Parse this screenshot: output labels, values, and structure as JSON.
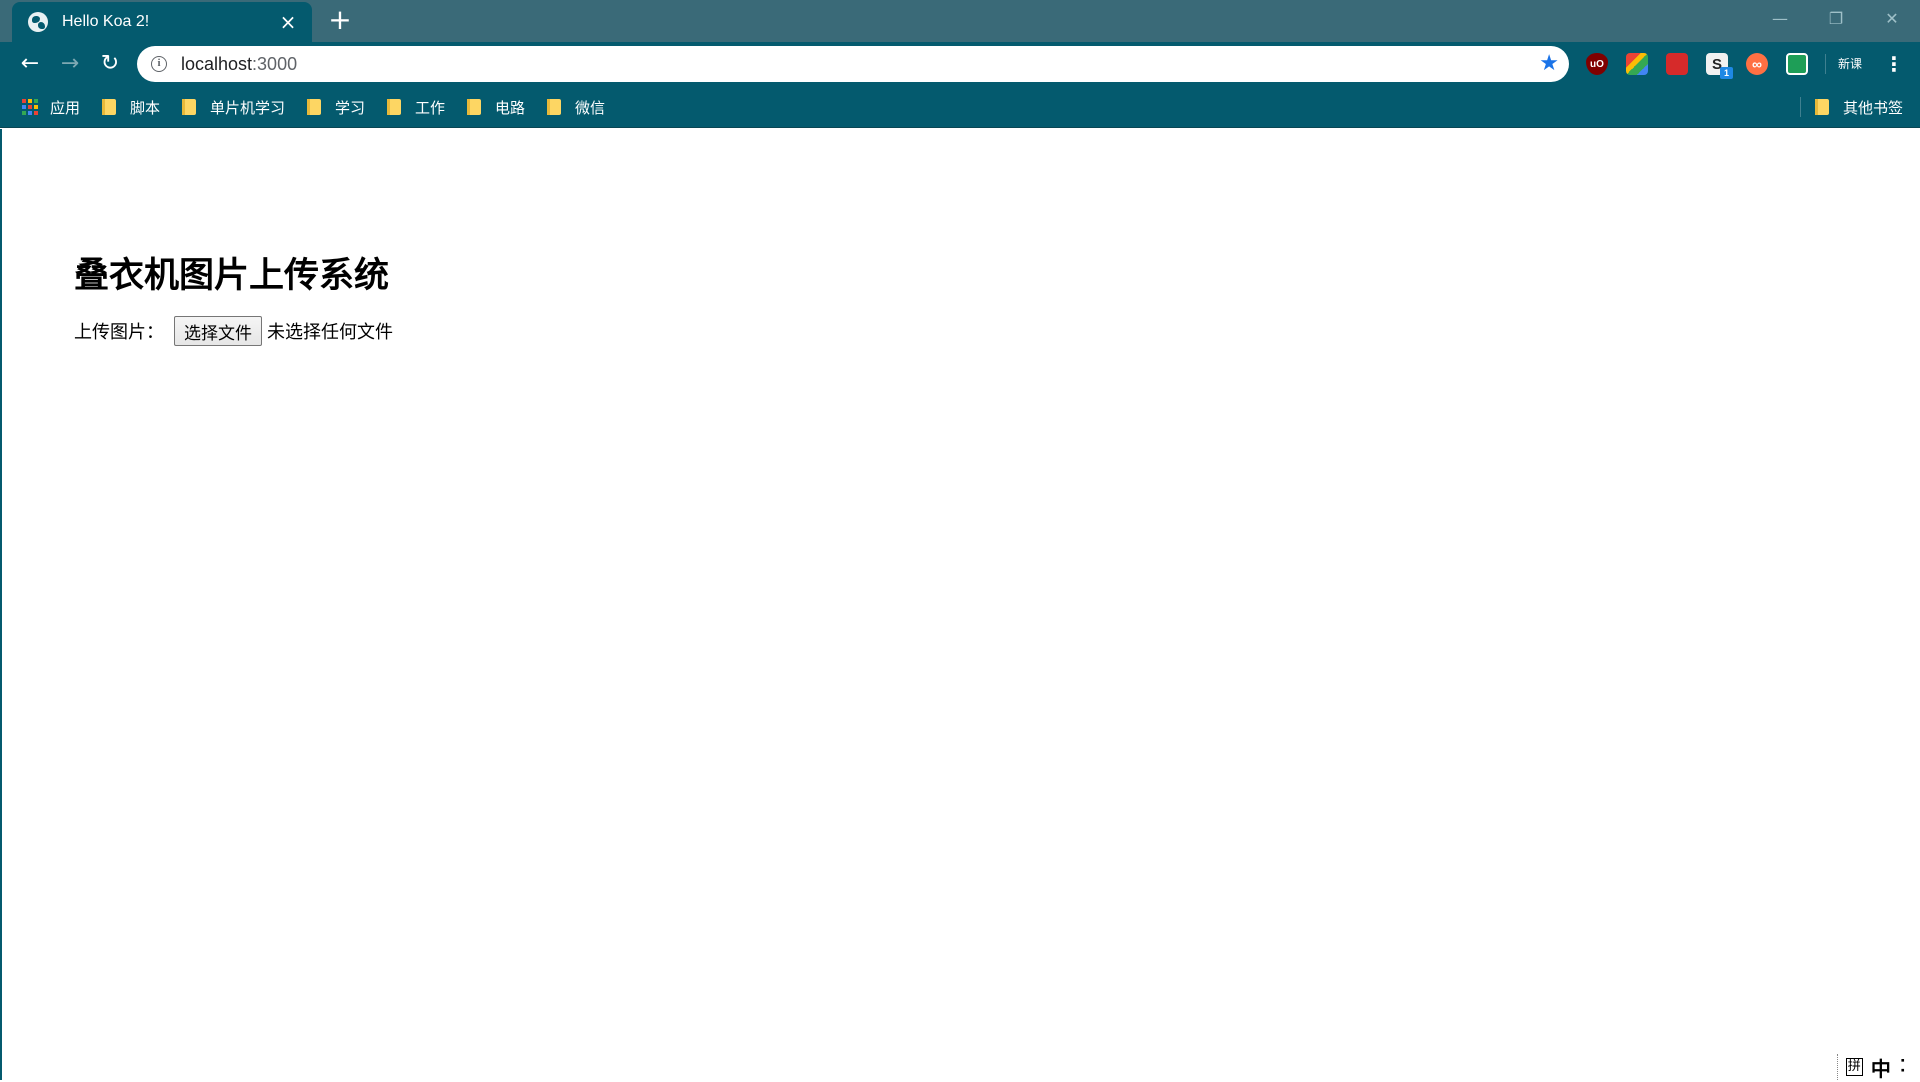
{
  "tab": {
    "title": "Hello Koa 2!",
    "close_glyph": "×",
    "new_tab_glyph": "+"
  },
  "window_controls": {
    "minimize": "—",
    "restore": "❐",
    "close": "✕"
  },
  "toolbar": {
    "back_glyph": "←",
    "forward_glyph": "→",
    "reload_glyph": "↻",
    "info_glyph": "i",
    "url_host": "localhost",
    "url_port": ":3000",
    "star_glyph": "★",
    "extensions": {
      "ublock": "uO",
      "s_label": "S",
      "s_badge": "1",
      "infinity": "∞",
      "xinke": "新课"
    },
    "menu_glyph": "⋮"
  },
  "bookmarks": {
    "apps": "应用",
    "items": [
      "脚本",
      "单片机学习",
      "学习",
      "工作",
      "电路",
      "微信"
    ],
    "other": "其他书签"
  },
  "page": {
    "title": "叠衣机图片上传系统",
    "upload_label": "上传图片：",
    "choose_button": "选择文件",
    "file_status": "未选择任何文件"
  },
  "ime": {
    "pinyin": "拼",
    "zh": "中",
    "dots": "⠅"
  },
  "colors": {
    "tabstrip": "#3a6a78",
    "toolbar": "#045a6e",
    "star": "#1a73e8",
    "folder": "#fdd663"
  },
  "icons": {
    "apps_grid_colors": [
      "#ea4335",
      "#fbbc05",
      "#34a853",
      "#4285f4",
      "#ea4335",
      "#fbbc05",
      "#34a853",
      "#4285f4",
      "#ea4335"
    ]
  }
}
